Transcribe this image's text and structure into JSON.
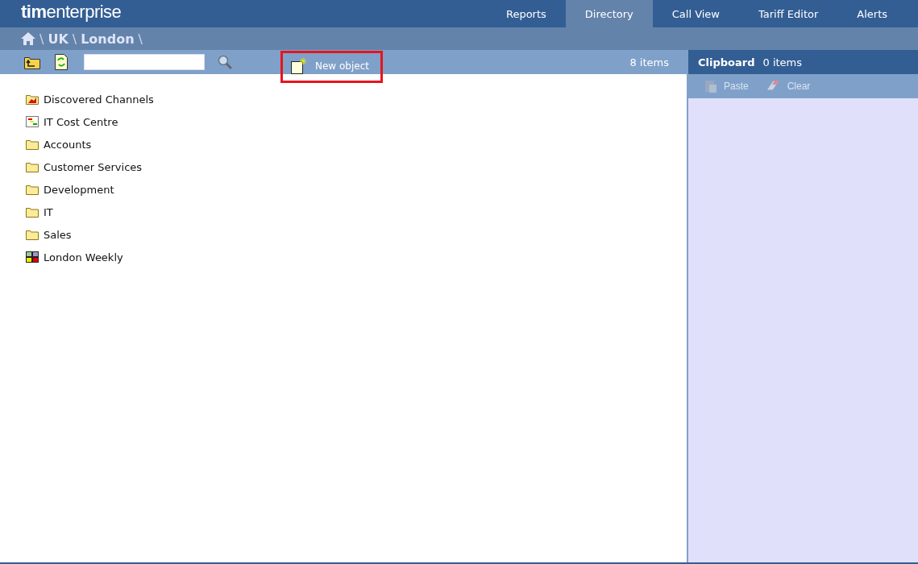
{
  "logo": "**tim**enterprise",
  "nav": [
    {
      "label": "Reports",
      "selected": false
    },
    {
      "label": "Directory",
      "selected": true
    },
    {
      "label": "Call View",
      "selected": false
    },
    {
      "label": "Tariff Editor",
      "selected": false
    },
    {
      "label": "Alerts",
      "selected": false
    }
  ],
  "breadcrumb": [
    {
      "kind": "separator",
      "text": "\\"
    },
    {
      "kind": "link",
      "text": "UK"
    },
    {
      "kind": "separator",
      "text": "\\"
    },
    {
      "kind": "link",
      "text": "London"
    },
    {
      "kind": "separator",
      "text": "\\"
    }
  ],
  "toolbar": {
    "new_object": {
      "label": "New object",
      "highlighted": true
    },
    "count": "8 items"
  },
  "items": [
    {
      "kind": "discovered",
      "label": "Discovered Channels"
    },
    {
      "kind": "cost-centre",
      "label": "IT Cost Centre"
    },
    {
      "kind": "folder",
      "label": "Accounts"
    },
    {
      "kind": "folder",
      "label": "Customer Services"
    },
    {
      "kind": "folder",
      "label": "Development"
    },
    {
      "kind": "folder",
      "label": "IT"
    },
    {
      "kind": "folder",
      "label": "Sales"
    },
    {
      "kind": "report",
      "label": "London Weekly"
    }
  ],
  "clipboard": {
    "title": "Clipboard",
    "count": "0 items",
    "actions": [
      {
        "kind": "paste",
        "label": "Paste",
        "disabled": true
      },
      {
        "kind": "clear",
        "label": "Clear",
        "disabled": true
      }
    ]
  }
}
